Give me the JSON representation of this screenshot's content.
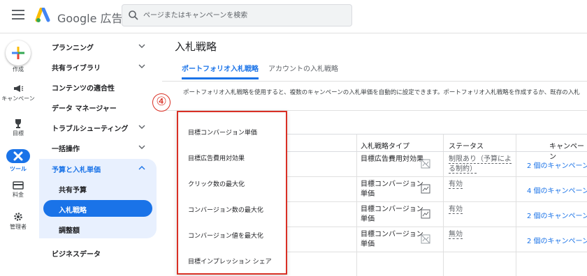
{
  "header": {
    "product_name": "Google 広告",
    "search_placeholder": "ページまたはキャンペーンを検索"
  },
  "rail": {
    "items": [
      {
        "label": "作成",
        "icon": "plus-icon"
      },
      {
        "label": "キャンペーン",
        "icon": "megaphone-icon"
      },
      {
        "label": "目標",
        "icon": "trophy-icon"
      },
      {
        "label": "ツール",
        "icon": "tools-icon",
        "active": true
      },
      {
        "label": "料金",
        "icon": "credit-card-icon"
      },
      {
        "label": "管理者",
        "icon": "gear-icon"
      }
    ]
  },
  "nav": {
    "items": [
      {
        "label": "プランニング",
        "chevron": true
      },
      {
        "label": "共有ライブラリ",
        "chevron": true
      },
      {
        "label": "コンテンツの適合性",
        "chevron": false
      },
      {
        "label": "データ マネージャー",
        "chevron": false
      },
      {
        "label": "トラブルシューティング",
        "chevron": true
      },
      {
        "label": "一括操作",
        "chevron": true
      },
      {
        "label": "予算と入札単価",
        "chevron": true,
        "expanded": true
      },
      {
        "label": "ビジネスデータ",
        "chevron": false
      }
    ],
    "sub_items": [
      {
        "label": "共有予算"
      },
      {
        "label": "入札戦略",
        "active": true
      },
      {
        "label": "調整額"
      }
    ]
  },
  "main": {
    "title": "入札戦略",
    "tabs": [
      {
        "label": "ポートフォリオ入札戦略",
        "active": true
      },
      {
        "label": "アカウントの入札戦略",
        "active": false
      }
    ],
    "description": "ポートフォリオ入札戦略を使用すると、複数のキャンペーンの入札単価を自動的に設定できます。ポートフォリオ入札戦略を作成するか、既存の入札"
  },
  "table": {
    "columns": [
      "入札戦略タイプ",
      "ステータス",
      "キャンペーン"
    ],
    "rows": [
      {
        "type": "目標広告費用対効果",
        "status": "制限あり（予算による制約）",
        "campaigns": "2 個のキャンペーン",
        "icon": "chart-off-icon"
      },
      {
        "type": "目標コンバージョン単価",
        "status": "有効",
        "campaigns": "4 個のキャンペーン",
        "icon": "chart-icon"
      },
      {
        "type": "目標コンバージョン単価",
        "status": "有効",
        "campaigns": "2 個のキャンペーン",
        "icon": "chart-icon"
      },
      {
        "type": "目標コンバージョン単価",
        "status": "無効",
        "campaigns": "2 個のキャンペーン",
        "icon": "chart-off-icon"
      }
    ]
  },
  "dropdown": {
    "number": "④",
    "options": [
      "目標コンバージョン単価",
      "目標広告費用対効果",
      "クリック数の最大化",
      "コンバージョン数の最大化",
      "コンバージョン値を最大化",
      "目標インプレッション シェア"
    ]
  },
  "colors": {
    "accent": "#1a73e8",
    "callout": "#d93025",
    "nav_group_bg": "#e8f0fe"
  }
}
